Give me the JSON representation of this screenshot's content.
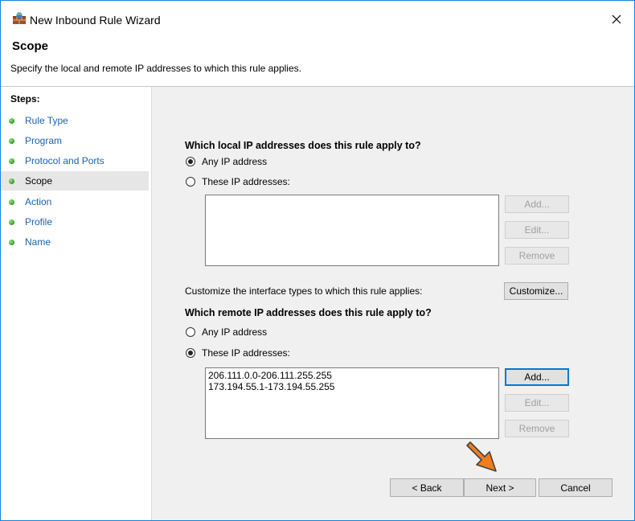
{
  "window": {
    "title": "New Inbound Rule Wizard",
    "icon": "firewall-icon",
    "close_glyph": "✕"
  },
  "header": {
    "title": "Scope",
    "description": "Specify the local and remote IP addresses to which this rule applies."
  },
  "steps": {
    "heading": "Steps:",
    "items": [
      {
        "label": "Rule Type"
      },
      {
        "label": "Program"
      },
      {
        "label": "Protocol and Ports"
      },
      {
        "label": "Scope"
      },
      {
        "label": "Action"
      },
      {
        "label": "Profile"
      },
      {
        "label": "Name"
      }
    ],
    "active_index": 3
  },
  "local": {
    "question": "Which local IP addresses does this rule apply to?",
    "any_label": "Any IP address",
    "these_label": "These IP addresses:",
    "selected": "any",
    "addresses": [],
    "add_label": "Add...",
    "edit_label": "Edit...",
    "remove_label": "Remove"
  },
  "customize": {
    "label": "Customize the interface types to which this rule applies:",
    "button_label": "Customize..."
  },
  "remote": {
    "question": "Which remote IP addresses does this rule apply to?",
    "any_label": "Any IP address",
    "these_label": "These IP addresses:",
    "selected": "these",
    "addresses": [
      "206.111.0.0-206.111.255.255",
      "173.194.55.1-173.194.55.255"
    ],
    "add_label": "Add...",
    "edit_label": "Edit...",
    "remove_label": "Remove"
  },
  "footer": {
    "back_label": "< Back",
    "next_label": "Next >",
    "cancel_label": "Cancel"
  },
  "colors": {
    "accent": "#0078d7",
    "step_link": "#1a62b0",
    "arrow": "#f07d1e"
  }
}
